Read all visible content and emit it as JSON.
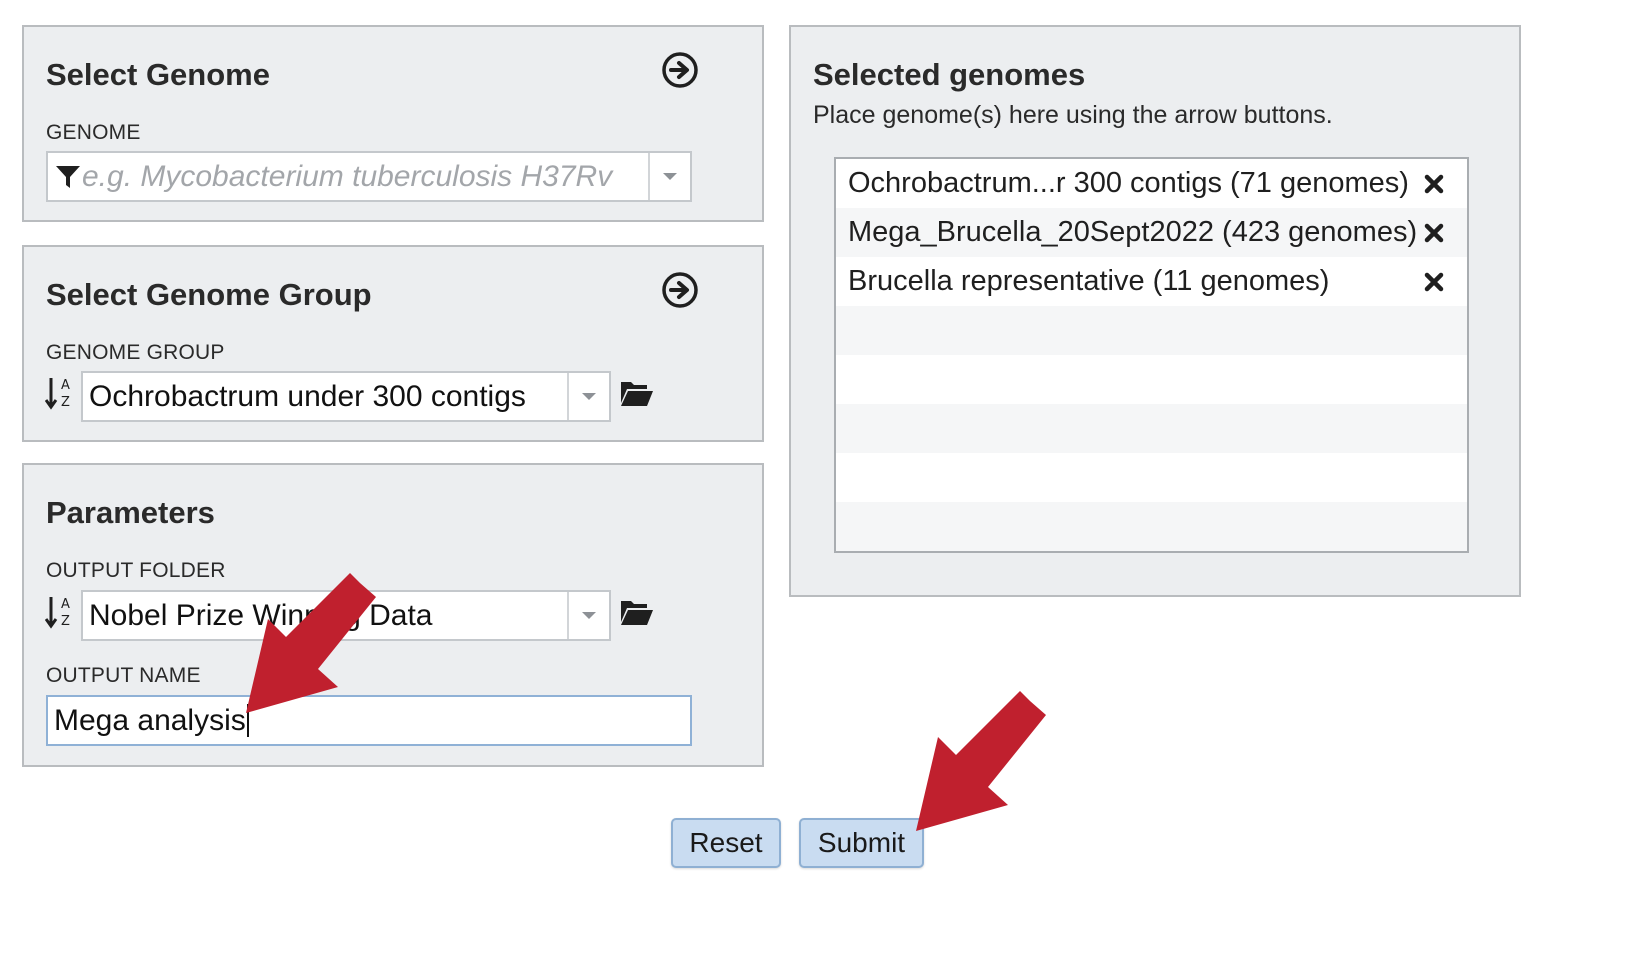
{
  "select_genome": {
    "title": "Select Genome",
    "label": "GENOME",
    "placeholder": "e.g. Mycobacterium tuberculosis H37Rv"
  },
  "select_genome_group": {
    "title": "Select Genome Group",
    "label": "GENOME GROUP",
    "value": "Ochrobactrum under 300 contigs"
  },
  "parameters": {
    "title": "Parameters",
    "output_folder_label": "OUTPUT FOLDER",
    "output_folder_value": "Nobel Prize Winning Data",
    "output_name_label": "OUTPUT NAME",
    "output_name_value": "Mega analysis"
  },
  "selected_genomes": {
    "title": "Selected genomes",
    "subtitle": "Place genome(s) here using the arrow buttons.",
    "items": [
      {
        "label": "Ochrobactrum...r 300 contigs (71 genomes)"
      },
      {
        "label": "Mega_Brucella_20Sept2022 (423 genomes)"
      },
      {
        "label": "Brucella representative (11 genomes)"
      }
    ]
  },
  "buttons": {
    "reset": "Reset",
    "submit": "Submit"
  },
  "colors": {
    "panel_bg": "#eceef0",
    "button_bg": "#c9dcf1",
    "annotation_arrow": "#c0202e"
  },
  "icons": {
    "add_arrow": "circle-arrow-right-icon",
    "filter": "filter-icon",
    "sort": "sort-alpha-icon",
    "folder": "folder-open-icon",
    "remove": "close-x-icon"
  }
}
